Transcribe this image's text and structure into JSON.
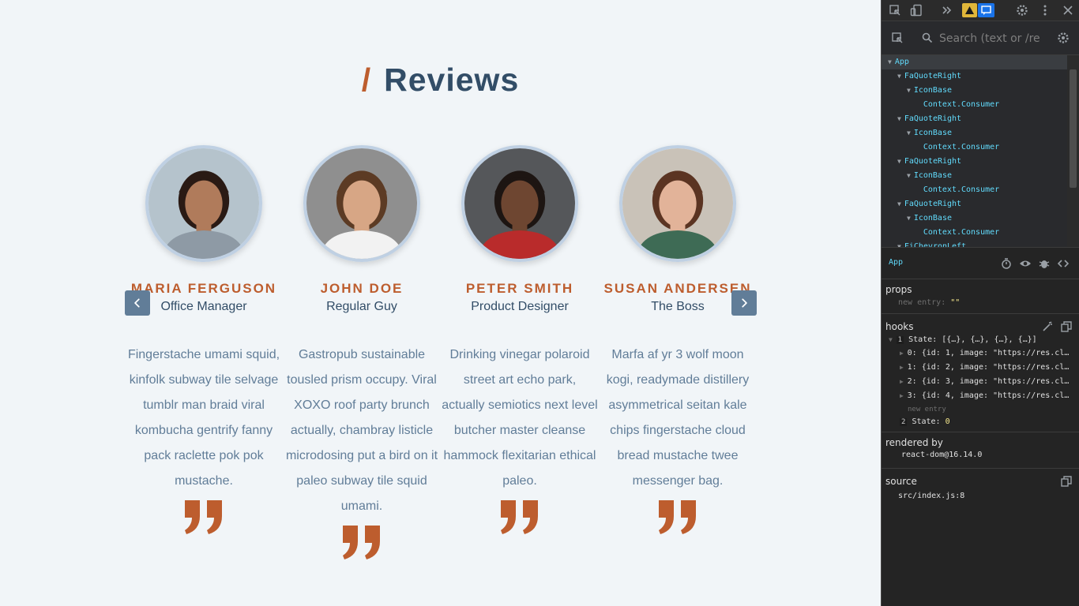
{
  "page": {
    "title": "Reviews",
    "title_slash": "/",
    "prev_label": "previous",
    "next_label": "next"
  },
  "reviews": [
    {
      "name": "MARIA FERGUSON",
      "job": "Office Manager",
      "text": "Fingerstache umami squid, kinfolk subway tile selvage tumblr man braid viral kombucha gentrify fanny pack raclette pok pok mustache.",
      "bg": "#b5c3cc",
      "skin": "#b07b5b",
      "hair": "#2a1a14",
      "shirt": "#8e9aa5"
    },
    {
      "name": "JOHN DOE",
      "job": "Regular Guy",
      "text": "Gastropub sustainable tousled prism occupy. Viral XOXO roof party brunch actually, chambray listicle microdosing put a bird on it paleo subway tile squid umami.",
      "bg": "#8f8f8f",
      "skin": "#d7a685",
      "hair": "#5c3b24",
      "shirt": "#f2f2f2"
    },
    {
      "name": "PETER SMITH",
      "job": "Product Designer",
      "text": "Drinking vinegar polaroid street art echo park, actually semiotics next level butcher master cleanse hammock flexitarian ethical paleo.",
      "bg": "#55575a",
      "skin": "#6e4631",
      "hair": "#1d1512",
      "shirt": "#b92b2b"
    },
    {
      "name": "SUSAN ANDERSEN",
      "job": "The Boss",
      "text": "Marfa af yr 3 wolf moon kogi, readymade distillery asymmetrical seitan kale chips fingerstache cloud bread mustache twee messenger bag.",
      "bg": "#c9c2b8",
      "skin": "#e2b399",
      "hair": "#5b3422",
      "shirt": "#3e6b55"
    }
  ],
  "devtools": {
    "search_placeholder": "Search (text or /rege",
    "tree": [
      {
        "label": "App",
        "indent": 0,
        "selected": true
      },
      {
        "label": "FaQuoteRight",
        "indent": 1
      },
      {
        "label": "IconBase",
        "indent": 2
      },
      {
        "label": "Context.Consumer",
        "indent": 3
      },
      {
        "label": "FaQuoteRight",
        "indent": 1
      },
      {
        "label": "IconBase",
        "indent": 2
      },
      {
        "label": "Context.Consumer",
        "indent": 3
      },
      {
        "label": "FaQuoteRight",
        "indent": 1
      },
      {
        "label": "IconBase",
        "indent": 2
      },
      {
        "label": "Context.Consumer",
        "indent": 3
      },
      {
        "label": "FaQuoteRight",
        "indent": 1
      },
      {
        "label": "IconBase",
        "indent": 2
      },
      {
        "label": "Context.Consumer",
        "indent": 3
      },
      {
        "label": "FiChevronLeft",
        "indent": 1
      }
    ],
    "selected_component": "App",
    "props_title": "props",
    "props_new_entry_key": "new entry",
    "props_new_entry_value": "\"\"",
    "hooks_title": "hooks",
    "hook1_index": "1",
    "hook1_label": "State:",
    "hook1_value": "[{…}, {…}, {…}, {…}]",
    "hook_items": [
      {
        "key": "0:",
        "value": "{id: 1, image: \"https://res.cl…"
      },
      {
        "key": "1:",
        "value": "{id: 2, image: \"https://res.cl…"
      },
      {
        "key": "2:",
        "value": "{id: 3, image: \"https://res.cl…"
      },
      {
        "key": "3:",
        "value": "{id: 4, image: \"https://res.cl…"
      }
    ],
    "hook_new_entry": "new entry",
    "hook2_index": "2",
    "hook2_label": "State:",
    "hook2_value": "0",
    "rendered_by_title": "rendered by",
    "rendered_by_value": "react-dom@16.14.0",
    "source_title": "source",
    "source_value": "src/index.js:8"
  }
}
